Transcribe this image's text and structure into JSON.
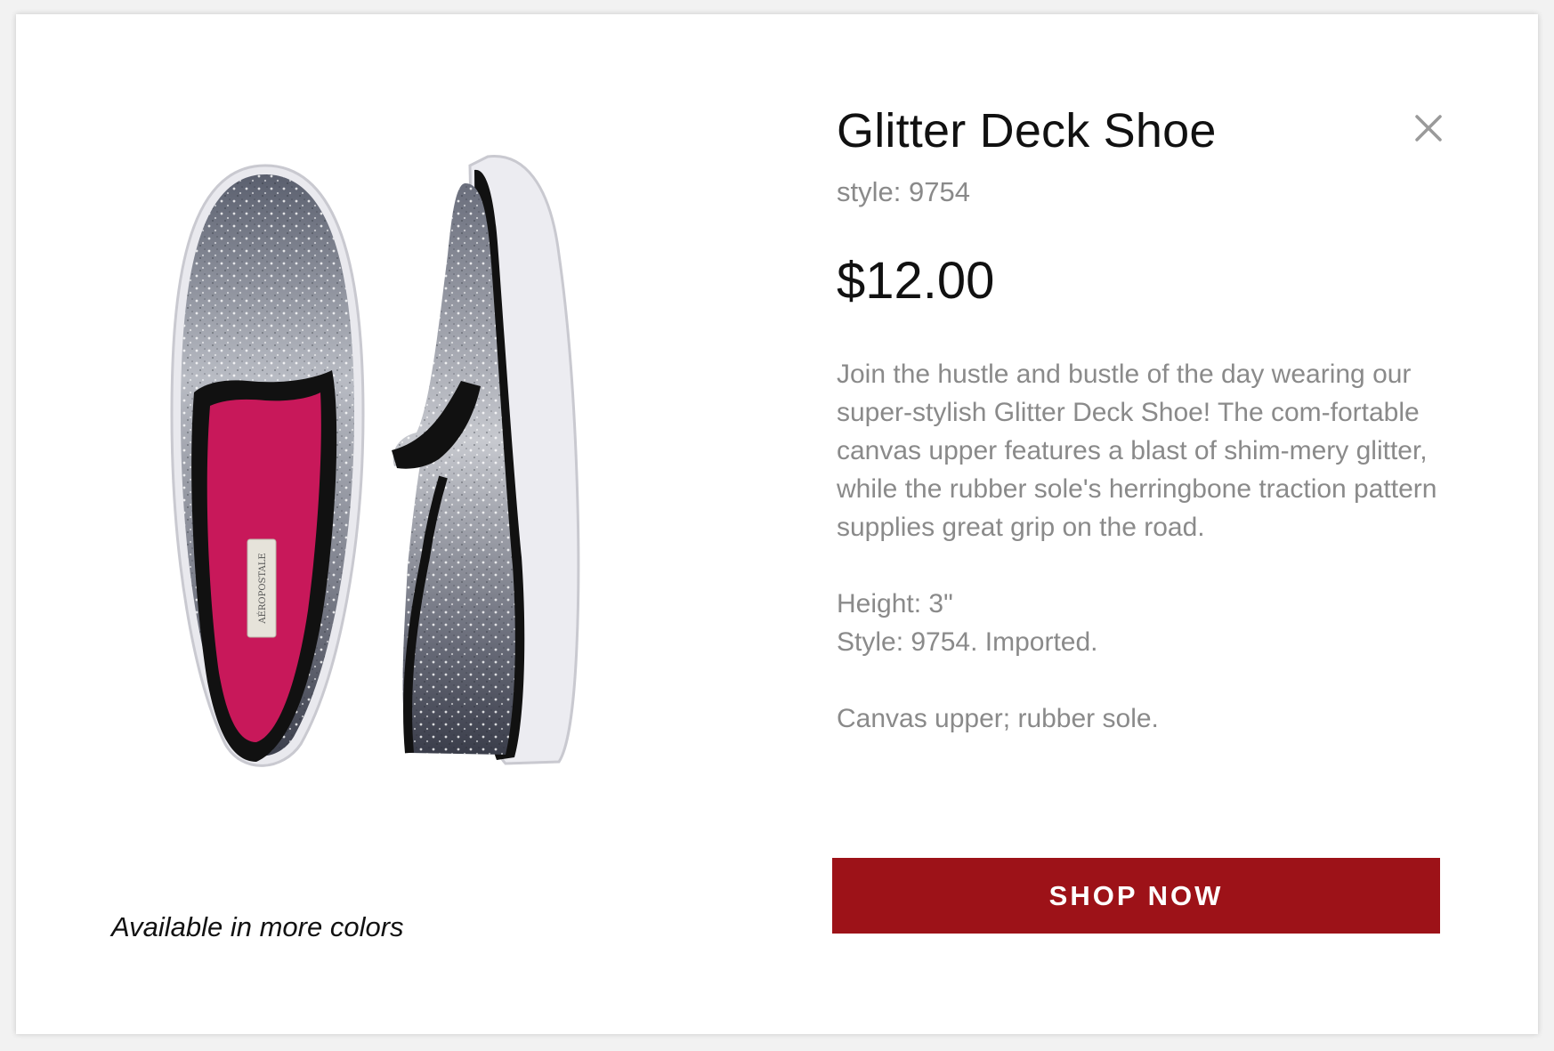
{
  "product": {
    "title": "Glitter Deck Shoe",
    "style_code": "style: 9754",
    "price": "$12.00",
    "description": "Join the hustle and bustle of the day wearing our super-stylish Glitter Deck Shoe! The com-fortable canvas upper features a blast of shim-mery glitter, while the rubber sole's herringbone traction pattern supplies great grip on the road.",
    "height": "Height: 3\"",
    "style_imported": "Style: 9754. Imported.",
    "materials": "Canvas upper; rubber sole.",
    "image_label_brand": "AÉROPOSTALE",
    "colors_note": "Available in more colors"
  },
  "actions": {
    "shop_now": "SHOP  NOW",
    "close_icon": "close-icon"
  },
  "colors": {
    "button_bg": "#9d1218",
    "insole": "#c8185a",
    "glitter": "#8a8f9a"
  }
}
